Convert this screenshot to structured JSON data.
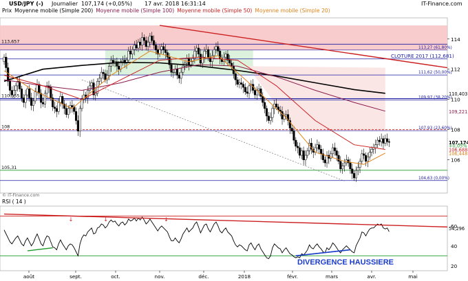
{
  "header": {
    "title": "USD/JPY (-)",
    "period": "Journalier",
    "last": "107,174 (+0,05%)",
    "datetime": "17 avr. 2018 16:31:14",
    "brand": "IT-Finance.com"
  },
  "legend": [
    {
      "name": "Prix",
      "color": "#000000"
    },
    {
      "name": "Moyenne mobile (Simple 200)",
      "color": "#000000"
    },
    {
      "name": "Moyenne mobile (Simple 100)",
      "color": "#8b1a4a"
    },
    {
      "name": "Moyenne mobile (Simple 50)",
      "color": "#cc1f1f"
    },
    {
      "name": "Moyenne mobile (Simple 20)",
      "color": "#e0841c"
    }
  ],
  "watermark": "© IT-Finance.com",
  "rsi_title": "RSI ( 14 )",
  "rsi_value": "54,296",
  "annotation": "DIVERGENCE HAUSSIERE",
  "left_labels": [
    "113,657",
    "110,055",
    "108",
    "105,31"
  ],
  "colors": {
    "up": "#ffffff",
    "down": "#000000",
    "sma200": "#000000",
    "sma100": "#8b1a4a",
    "sma50": "#cc1f1f",
    "sma20": "#e0841c",
    "fib": "#1a1aa0",
    "trend": "#cc1f1f",
    "support": "#1f9a2a",
    "zone_red": "#f7c6c6",
    "zone_green": "#d6f0d6",
    "label_blue": "#1a1aa0",
    "annotation": "#1a3ccc"
  },
  "chart_data": {
    "type": "candlestick",
    "x_tick_labels": [
      "août",
      "sept.",
      "oct.",
      "nov.",
      "déc.",
      "2018",
      "févr.",
      "mars",
      "avr.",
      "mai"
    ],
    "ylim": [
      103.8,
      115.4
    ],
    "y_ticks": [
      106,
      108,
      110,
      112,
      114
    ],
    "price_labels": [
      {
        "value": 110.403,
        "text": "110,403",
        "color": "#000000"
      },
      {
        "value": 109.221,
        "text": "109,221",
        "color": "#8b1a4a"
      },
      {
        "value": 107.174,
        "text": "107,174",
        "color": "#000000"
      },
      {
        "value": 106.972,
        "text": "+0,05%",
        "color": "#1f9a2a"
      },
      {
        "value": 106.688,
        "text": "106,688",
        "color": "#cc1f1f"
      },
      {
        "value": 106.448,
        "text": "106,448",
        "color": "#e0841c"
      }
    ],
    "fib_levels": [
      {
        "value": 113.27,
        "label": "113,27 (61,80%)"
      },
      {
        "value": 112.681,
        "label": "CLOTURE 2017 (112,681)"
      },
      {
        "value": 111.62,
        "label": "111,62 (50,00%)"
      },
      {
        "value": 109.97,
        "label": "109,97 (38,20%)"
      },
      {
        "value": 107.93,
        "label": "107,93 (23,60%)"
      },
      {
        "value": 104.63,
        "label": "104,63 (0,00%)"
      }
    ],
    "horizontal_levels": [
      113.657,
      110.055,
      108.0,
      105.31
    ],
    "closes": [
      112.8,
      112.1,
      111.2,
      110.6,
      110.3,
      110.6,
      110.9,
      111.2,
      110.7,
      110.1,
      109.8,
      110.3,
      110.7,
      110.1,
      109.6,
      109.9,
      110.5,
      111.0,
      110.4,
      109.8,
      109.7,
      110.4,
      110.9,
      110.8,
      110.1,
      109.5,
      109.4,
      109.2,
      109.8,
      110.2,
      109.7,
      109.4,
      109.0,
      109.4,
      109.6,
      109.5,
      109.2,
      108.6,
      107.9,
      109.4,
      110.0,
      110.3,
      110.1,
      110.6,
      110.9,
      111.1,
      110.3,
      110.4,
      111.2,
      111.4,
      111.8,
      111.7,
      111.3,
      111.6,
      112.2,
      112.6,
      112.4,
      112.5,
      112.2,
      112.0,
      112.5,
      112.6,
      112.4,
      112.6,
      113.2,
      113.0,
      113.3,
      113.6,
      113.4,
      113.8,
      113.6,
      114.1,
      113.9,
      113.5,
      113.8,
      114.2,
      113.9,
      113.6,
      113.3,
      113.0,
      113.3,
      113.5,
      113.3,
      113.1,
      112.8,
      112.3,
      111.8,
      111.8,
      112.0,
      111.6,
      111.4,
      111.8,
      112.2,
      112.4,
      112.7,
      112.3,
      112.5,
      112.7,
      113.2,
      113.4,
      113.0,
      112.4,
      112.8,
      113.2,
      113.3,
      112.8,
      112.5,
      112.9,
      113.3,
      113.5,
      113.2,
      112.7,
      112.5,
      112.8,
      113.0,
      112.6,
      112.4,
      112.2,
      111.7,
      111.3,
      111.0,
      111.1,
      111.0,
      110.8,
      110.5,
      110.4,
      110.9,
      111.0,
      110.6,
      110.3,
      110.6,
      110.7,
      110.2,
      109.8,
      109.4,
      108.9,
      108.6,
      108.8,
      109.4,
      109.7,
      109.5,
      109.3,
      109.2,
      108.7,
      108.9,
      109.0,
      108.6,
      108.1,
      107.9,
      107.3,
      106.9,
      106.8,
      106.3,
      106.6,
      106.0,
      106.3,
      106.6,
      107.1,
      106.7,
      106.5,
      106.8,
      107.0,
      106.7,
      106.4,
      106.0,
      105.8,
      106.3,
      106.1,
      106.4,
      106.8,
      106.6,
      106.3,
      105.9,
      105.4,
      105.6,
      105.8,
      106.0,
      105.8,
      105.4,
      105.1,
      104.8,
      105.3,
      105.5,
      105.9,
      106.4,
      106.3,
      105.9,
      106.2,
      106.5,
      106.7,
      106.8,
      107.0,
      107.3,
      107.2,
      107.4,
      107.1,
      107.4,
      107.2,
      107.17
    ],
    "sma200": [
      {
        "i": 0,
        "v": 111.2
      },
      {
        "i": 20,
        "v": 112.0
      },
      {
        "i": 40,
        "v": 112.25
      },
      {
        "i": 60,
        "v": 112.45
      },
      {
        "i": 80,
        "v": 112.42
      },
      {
        "i": 100,
        "v": 112.22
      },
      {
        "i": 120,
        "v": 111.92
      },
      {
        "i": 140,
        "v": 111.55
      },
      {
        "i": 160,
        "v": 111.1
      },
      {
        "i": 180,
        "v": 110.65
      },
      {
        "i": 196,
        "v": 110.403
      }
    ],
    "sma100": [
      {
        "i": 0,
        "v": 111.3
      },
      {
        "i": 20,
        "v": 110.9
      },
      {
        "i": 40,
        "v": 110.6
      },
      {
        "i": 60,
        "v": 111.1
      },
      {
        "i": 80,
        "v": 111.8
      },
      {
        "i": 100,
        "v": 112.3
      },
      {
        "i": 120,
        "v": 112.2
      },
      {
        "i": 140,
        "v": 111.5
      },
      {
        "i": 160,
        "v": 110.6
      },
      {
        "i": 180,
        "v": 109.8
      },
      {
        "i": 196,
        "v": 109.221
      }
    ],
    "sma50": [
      {
        "i": 0,
        "v": 111.6
      },
      {
        "i": 20,
        "v": 110.9
      },
      {
        "i": 40,
        "v": 110.0
      },
      {
        "i": 60,
        "v": 111.3
      },
      {
        "i": 80,
        "v": 112.6
      },
      {
        "i": 100,
        "v": 112.8
      },
      {
        "i": 120,
        "v": 112.6
      },
      {
        "i": 140,
        "v": 110.9
      },
      {
        "i": 160,
        "v": 108.6
      },
      {
        "i": 180,
        "v": 107.0
      },
      {
        "i": 196,
        "v": 106.688
      }
    ],
    "sma20": [
      {
        "i": 0,
        "v": 111.9
      },
      {
        "i": 15,
        "v": 110.6
      },
      {
        "i": 35,
        "v": 109.4
      },
      {
        "i": 55,
        "v": 111.6
      },
      {
        "i": 75,
        "v": 113.2
      },
      {
        "i": 95,
        "v": 112.5
      },
      {
        "i": 110,
        "v": 112.9
      },
      {
        "i": 125,
        "v": 111.2
      },
      {
        "i": 145,
        "v": 108.8
      },
      {
        "i": 160,
        "v": 106.5
      },
      {
        "i": 175,
        "v": 105.9
      },
      {
        "i": 185,
        "v": 105.7
      },
      {
        "i": 196,
        "v": 106.448
      }
    ],
    "downtrend_line": [
      {
        "i": 80,
        "v": 114.9
      },
      {
        "i": 196,
        "v": 112.1
      }
    ],
    "support_line": [
      {
        "i": 40,
        "v": 111.3
      },
      {
        "i": 175,
        "v": 104.6
      }
    ],
    "rsi": {
      "ylim": [
        15,
        80
      ],
      "y_ticks": [
        20,
        40,
        60
      ],
      "overbought": 70,
      "oversold": 30,
      "values": [
        56,
        52,
        48,
        44,
        42,
        45,
        48,
        50,
        46,
        42,
        40,
        45,
        48,
        44,
        40,
        43,
        48,
        52,
        47,
        42,
        40,
        46,
        50,
        49,
        44,
        39,
        38,
        36,
        42,
        46,
        42,
        39,
        36,
        40,
        42,
        41,
        38,
        34,
        30,
        42,
        48,
        51,
        50,
        54,
        56,
        58,
        52,
        53,
        58,
        59,
        62,
        61,
        58,
        60,
        64,
        66,
        64,
        65,
        62,
        60,
        63,
        64,
        61,
        63,
        67,
        65,
        66,
        68,
        65,
        68,
        66,
        69,
        66,
        62,
        64,
        67,
        64,
        61,
        58,
        55,
        58,
        60,
        58,
        56,
        54,
        49,
        45,
        45,
        48,
        45,
        43,
        47,
        52,
        55,
        58,
        54,
        56,
        58,
        62,
        64,
        59,
        53,
        57,
        61,
        62,
        57,
        54,
        58,
        62,
        64,
        60,
        55,
        53,
        56,
        58,
        54,
        52,
        50,
        45,
        41,
        39,
        41,
        40,
        38,
        36,
        35,
        41,
        43,
        39,
        36,
        40,
        42,
        37,
        34,
        31,
        28,
        27,
        30,
        38,
        42,
        40,
        38,
        37,
        33,
        36,
        38,
        35,
        32,
        31,
        29,
        28,
        29,
        28,
        32,
        31,
        33,
        36,
        41,
        38,
        37,
        40,
        42,
        39,
        37,
        34,
        33,
        38,
        36,
        39,
        43,
        41,
        38,
        35,
        33,
        36,
        38,
        40,
        38,
        36,
        34,
        33,
        40,
        44,
        48,
        54,
        53,
        50,
        54,
        57,
        58,
        58,
        60,
        62,
        61,
        62,
        58,
        57,
        58,
        54.3
      ],
      "divergence_price_line": [
        {
          "i": 150,
          "v": 30
        },
        {
          "i": 178,
          "v": 36
        }
      ],
      "green_lines": [
        [
          {
            "i": 12,
            "v": 35
          },
          {
            "i": 25,
            "v": 38
          }
        ],
        [
          {
            "i": 150,
            "v": 30
          },
          {
            "i": 178,
            "v": 36
          }
        ]
      ],
      "trend_line": [
        {
          "i": 0,
          "v": 72
        },
        {
          "i": 196,
          "v": 59
        }
      ],
      "markers": [
        {
          "i": 34
        },
        {
          "i": 52
        },
        {
          "i": 83
        }
      ]
    }
  }
}
